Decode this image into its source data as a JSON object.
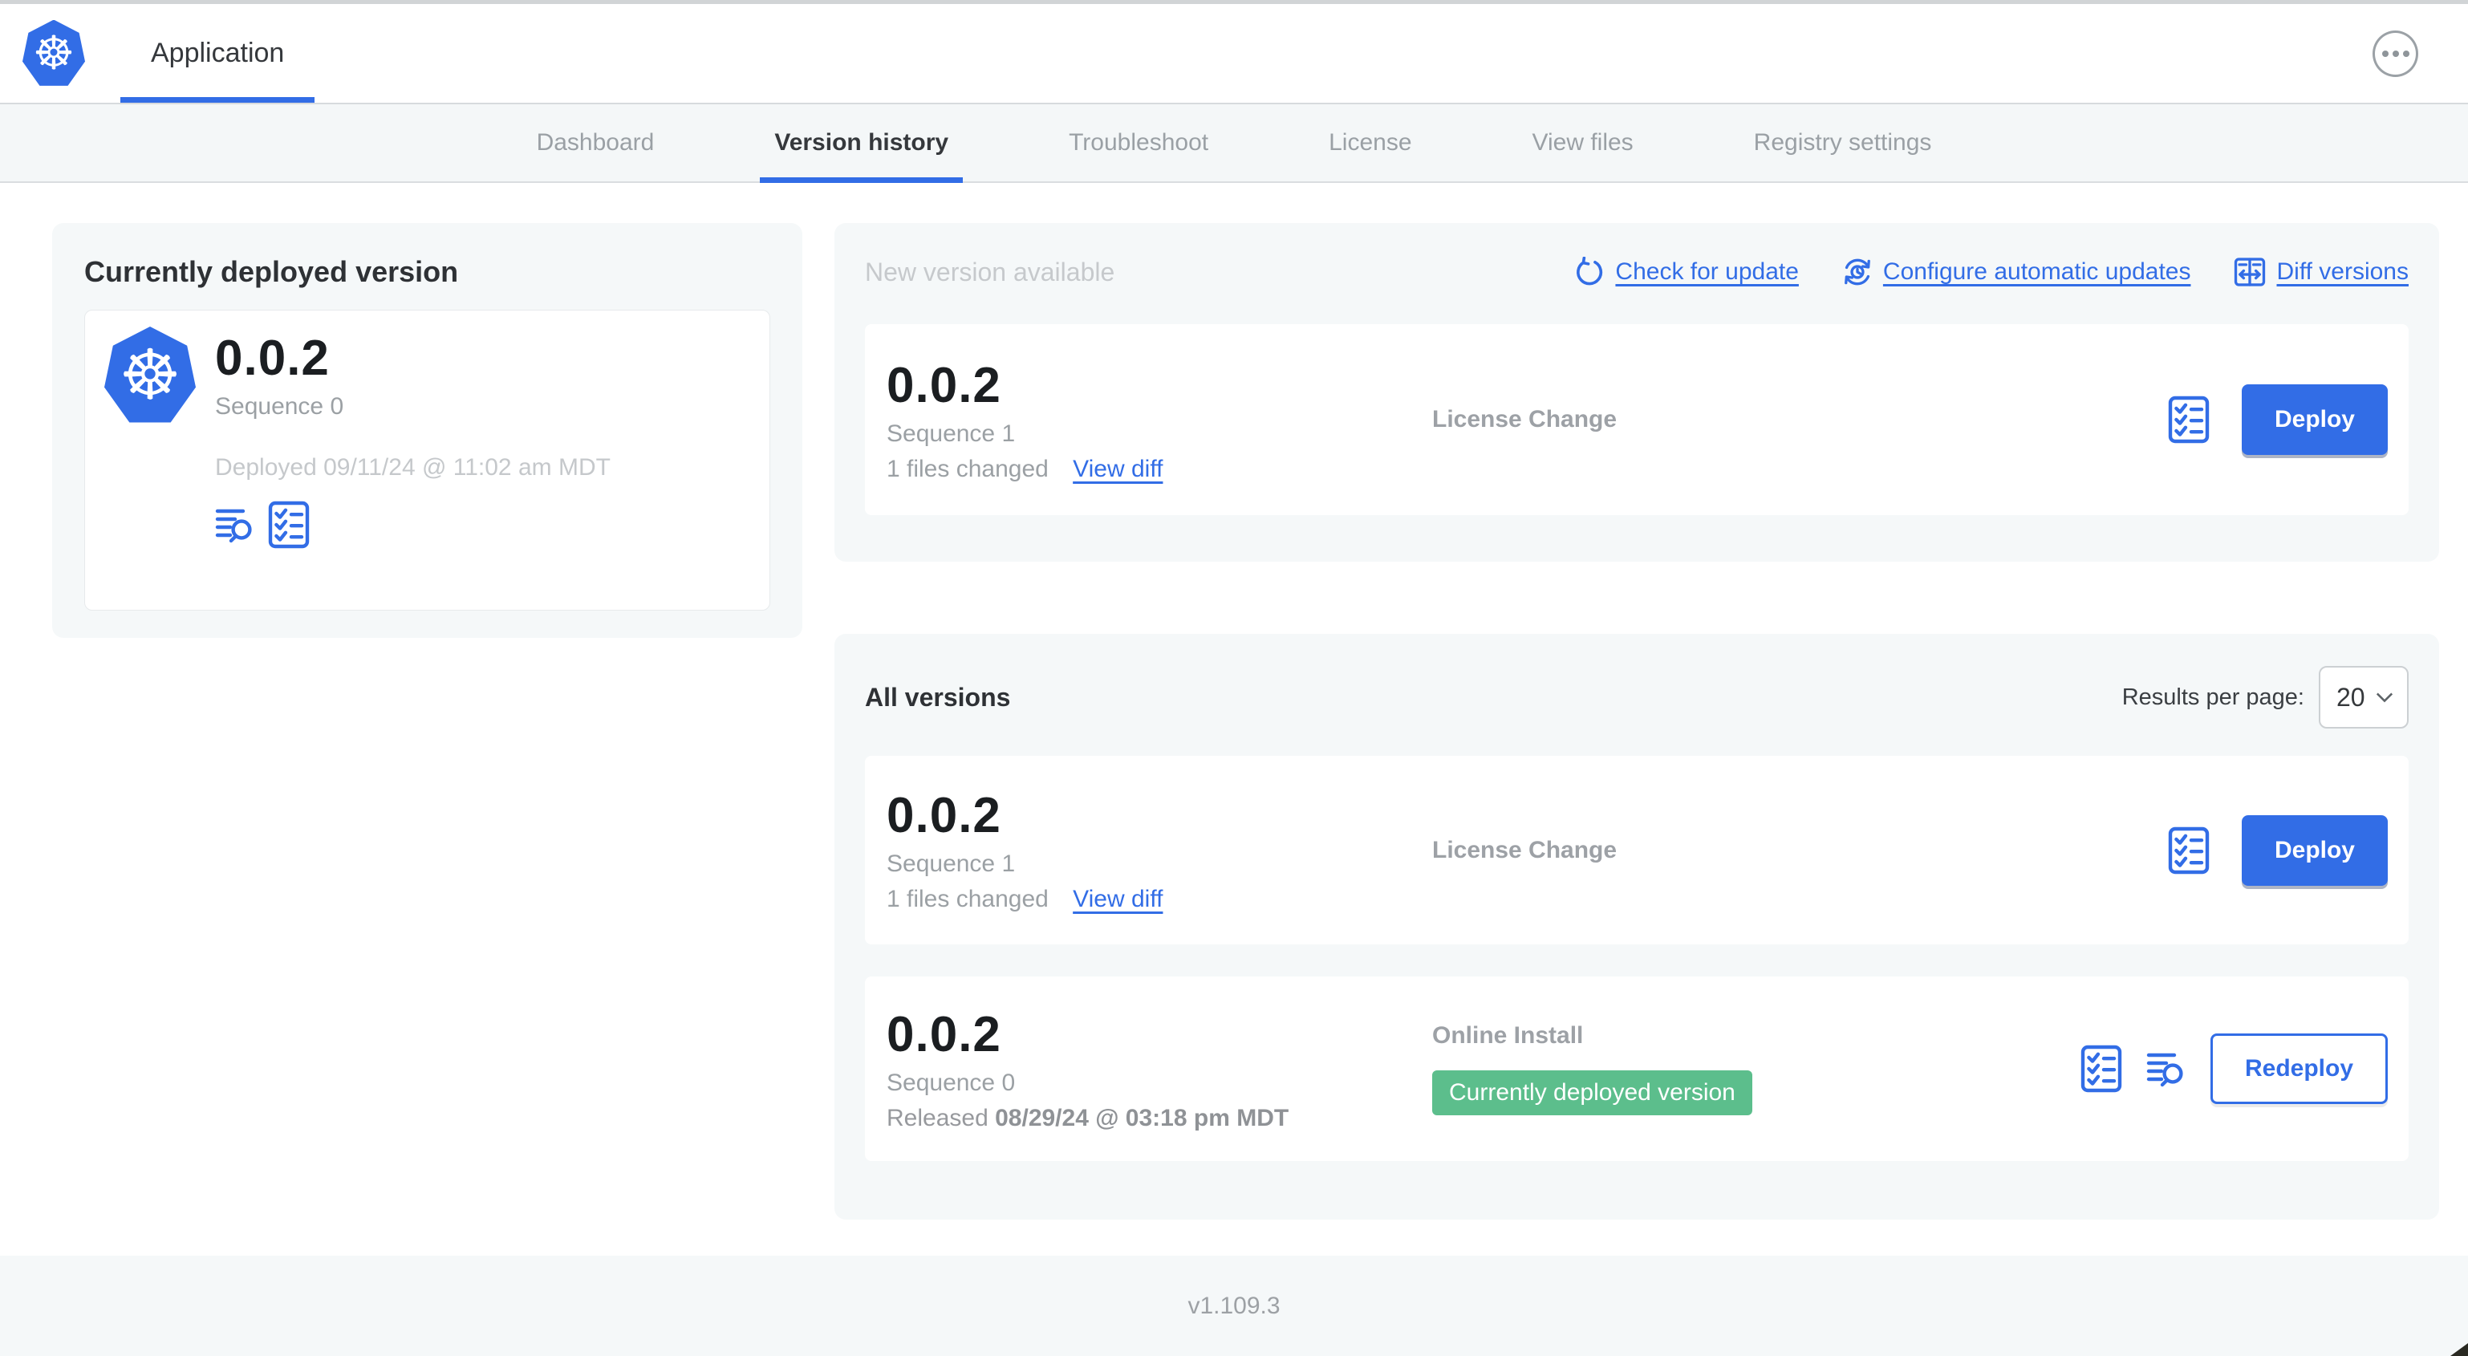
{
  "colors": {
    "accent_blue": "#326de6",
    "badge_green": "#5cbe8c",
    "panel_gray": "#f5f8f9"
  },
  "header": {
    "app_tab_label": "Application"
  },
  "nav": {
    "tabs": [
      "Dashboard",
      "Version history",
      "Troubleshoot",
      "License",
      "View files",
      "Registry settings"
    ],
    "active_tab": "Version history"
  },
  "current_version": {
    "title": "Currently deployed version",
    "version": "0.0.2",
    "sequence": "Sequence 0",
    "deployed": "Deployed 09/11/24 @ 11:02 am MDT"
  },
  "new_version": {
    "title": "New version available",
    "check_for_update_label": "Check for update",
    "configure_updates_label": "Configure automatic updates",
    "diff_versions_label": "Diff versions",
    "card": {
      "version": "0.0.2",
      "sequence": "Sequence 1",
      "files_changed": "1 files changed",
      "view_diff_label": "View diff",
      "source": "License Change",
      "deploy_label": "Deploy"
    }
  },
  "all_versions": {
    "title": "All versions",
    "results_per_page_label": "Results per page:",
    "results_per_page_value": "20",
    "rows": [
      {
        "version": "0.0.2",
        "sequence": "Sequence 1",
        "files_changed": "1 files changed",
        "view_diff_label": "View diff",
        "source": "License Change",
        "action_label": "Deploy"
      },
      {
        "version": "0.0.2",
        "sequence": "Sequence 0",
        "released_prefix": "Released",
        "released_date": "08/29/24 @ 03:18 pm MDT",
        "source": "Online Install",
        "badge": "Currently deployed version",
        "action_label": "Redeploy"
      }
    ]
  },
  "footer": {
    "app_version": "v1.109.3"
  }
}
